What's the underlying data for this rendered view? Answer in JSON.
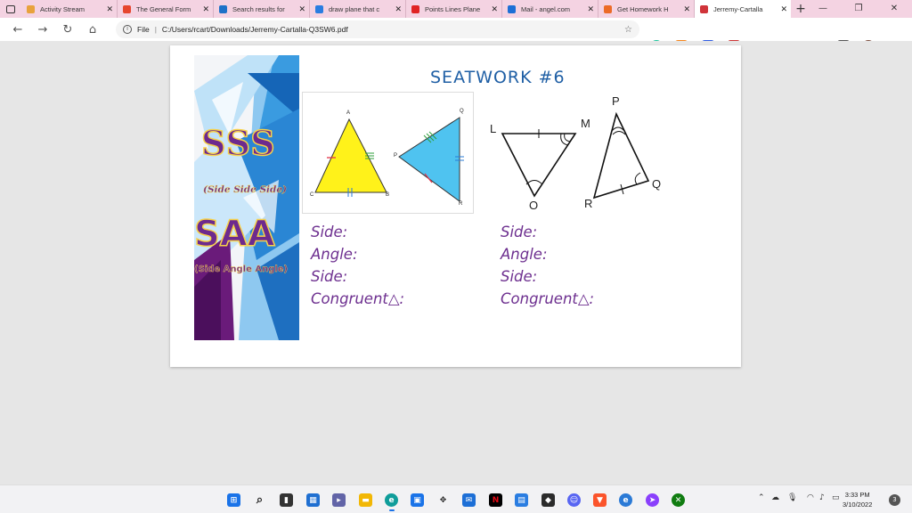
{
  "browser": {
    "tabs": [
      {
        "label": "Activity Stream",
        "color": "#e8a23c"
      },
      {
        "label": "The General Form",
        "color": "#e6462e"
      },
      {
        "label": "Search results for",
        "color": "#1e72c8"
      },
      {
        "label": "draw plane that c",
        "color": "#2a7de1"
      },
      {
        "label": "Points Lines Plane",
        "color": "#e02424"
      },
      {
        "label": "Mail - angel.com",
        "color": "#1d6fd6"
      },
      {
        "label": "Get Homework H",
        "color": "#ec6b27"
      },
      {
        "label": "Jerremy-Cartalla",
        "color": "#d0343a"
      }
    ],
    "address": {
      "scheme": "File",
      "url": "C:/Users/rcart/Downloads/Jerremy-Cartalla-Q3SW6.pdf"
    }
  },
  "document": {
    "title": "SEATWORK #6",
    "banner": {
      "sss": "SSS",
      "sss_sub": "(Side Side Side)",
      "saa": "SAA",
      "saa_sub": "(Side Angle Angle)"
    },
    "figure1": {
      "labels": [
        "A",
        "C",
        "B",
        "Q",
        "P",
        "R"
      ]
    },
    "figure2": {
      "labels": [
        "L",
        "M",
        "O",
        "P",
        "R",
        "Q"
      ]
    },
    "left_questions": [
      "Side:",
      "Angle:",
      "Side:",
      "Congruent△:"
    ],
    "right_questions": [
      "Side:",
      "Angle:",
      "Side:",
      "Congruent△:"
    ]
  },
  "taskbar": {
    "time": "3:33 PM",
    "date": "3/10/2022",
    "notifications": "3"
  }
}
